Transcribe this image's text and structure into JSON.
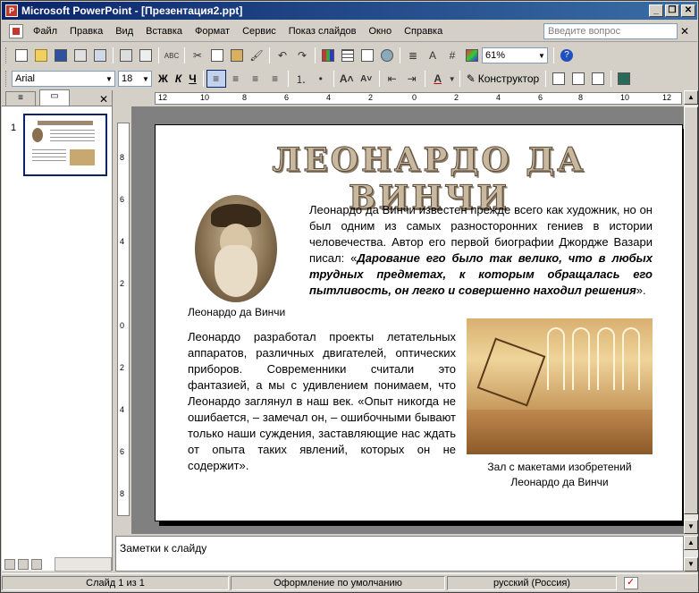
{
  "window": {
    "title": "Microsoft PowerPoint - [Презентация2.ppt]",
    "controls": {
      "minimize": "_",
      "restore": "❐",
      "close": "✕"
    }
  },
  "menubar": {
    "items": [
      "Файл",
      "Правка",
      "Вид",
      "Вставка",
      "Формат",
      "Сервис",
      "Показ слайдов",
      "Окно",
      "Справка"
    ],
    "help_placeholder": "Введите вопрос",
    "doc_close": "✕"
  },
  "toolbar_standard": {
    "zoom": "61%",
    "icons": [
      "new-icon",
      "open-icon",
      "save-icon",
      "permission-icon",
      "email-icon",
      "print-icon",
      "print-preview-icon",
      "spelling-icon",
      "cut-icon",
      "copy-icon",
      "paste-icon",
      "format-painter-icon",
      "undo-icon",
      "redo-icon",
      "chart-icon",
      "table-icon",
      "tables-borders-icon",
      "hyperlink-icon",
      "expand-icon",
      "show-formatting-icon",
      "grid-icon",
      "color-grayscale-icon",
      "help-icon"
    ]
  },
  "toolbar_formatting": {
    "font": "Arial",
    "size": "18",
    "bold": "Ж",
    "italic": "К",
    "underline": "Ч",
    "design_label": "Конструктор"
  },
  "panel": {
    "tab_outline": "≡",
    "tab_slides": "▭",
    "close": "✕",
    "slide_number": "1"
  },
  "ruler": {
    "h_labels": [
      "12",
      "10",
      "8",
      "6",
      "4",
      "2",
      "0",
      "2",
      "4",
      "6",
      "8",
      "10",
      "12"
    ],
    "v_labels": [
      "8",
      "6",
      "4",
      "2",
      "0",
      "2",
      "4",
      "6",
      "8"
    ]
  },
  "slide": {
    "title": "ЛЕОНАРДО ДА ВИНЧИ",
    "portrait_caption": "Леонардо да Винчи",
    "para1_plain": "Леонардо да Винчи известен прежде всего как художник, но он был одним из самых разносторонних гениев в истории человечества. Автор его первой биографии Джордже Вазари писал: «",
    "para1_bold": "Дарование его было так велико, что в любых трудных предметах, к которым обращалась его пытливость, он легко и совершенно находил решения",
    "para1_end": "».",
    "para2": "Леонардо разработал проекты летательных аппаратов, различных двигателей, оптических приборов. Современники считали это фантазией, а мы с удивлением понимаем, что Леонардо заглянул в наш век. «Опыт никогда не ошибается, – замечал он, – ошибочными бывают только наши суждения, заставляющие нас ждать от опыта таких явлений, которых он не содержит».",
    "image_caption": "Зал с макетами изобретений Леонардо да Винчи"
  },
  "notes": {
    "placeholder": "Заметки к слайду"
  },
  "status": {
    "slide": "Слайд 1 из 1",
    "design": "Оформление по умолчанию",
    "language": "русский (Россия)"
  }
}
